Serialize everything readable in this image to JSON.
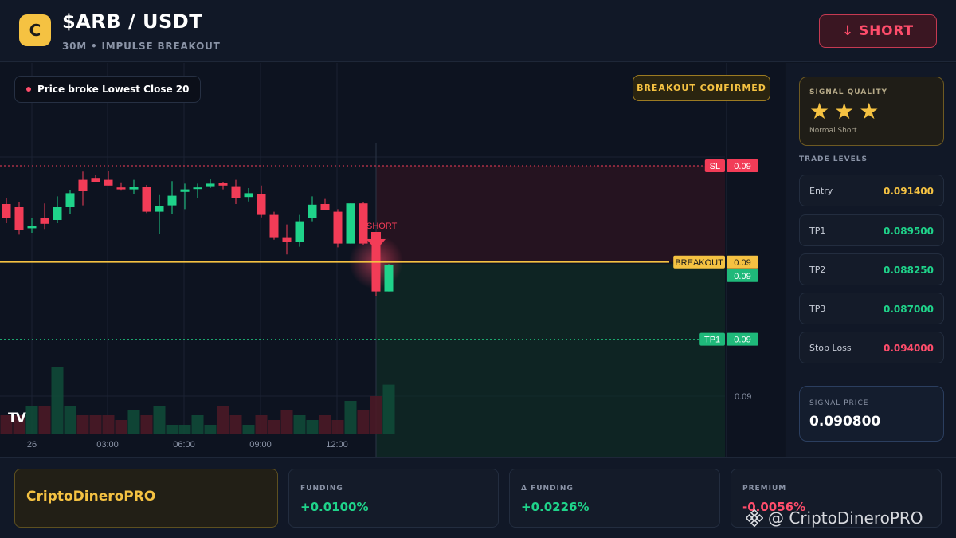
{
  "header": {
    "logo_letter": "C",
    "pair": "$ARB / USDT",
    "subtitle": "30M • IMPULSE BREAKOUT",
    "short_button": "SHORT"
  },
  "chart": {
    "note": "Price broke Lowest Close 20",
    "status_badge": "BREAKOUT CONFIRMED",
    "signal_marker": "SHORT",
    "tv_logo": "TV",
    "level_tags": [
      {
        "name": "SL",
        "value": "0.09",
        "color": "#f23c57"
      },
      {
        "name": "BREAKOUT",
        "value": "0.09",
        "color": "#f5c242"
      },
      {
        "name": "",
        "value": "0.09",
        "color": "#1fb97a"
      },
      {
        "name": "TP1",
        "value": "0.09",
        "color": "#1fb97a"
      }
    ],
    "axis_label": "0.09",
    "time_labels": [
      "26",
      "03:00",
      "06:00",
      "09:00",
      "12:00"
    ]
  },
  "chart_data": {
    "type": "candlestick",
    "candles": [
      {
        "o": 6,
        "h": 7,
        "l": 3,
        "c": 3.8
      },
      {
        "o": 5.5,
        "h": 6.3,
        "l": 1.2,
        "c": 2.0
      },
      {
        "o": 2.2,
        "h": 3.8,
        "l": 1.5,
        "c": 2.6
      },
      {
        "o": 3.8,
        "h": 6.1,
        "l": 2.1,
        "c": 2.9
      },
      {
        "o": 3.5,
        "h": 7.2,
        "l": 3.0,
        "c": 5.5
      },
      {
        "o": 5.5,
        "h": 8.2,
        "l": 4.5,
        "c": 7.7
      },
      {
        "o": 9.8,
        "h": 11.1,
        "l": 5.8,
        "c": 8.0
      },
      {
        "o": 10.1,
        "h": 10.6,
        "l": 9.5,
        "c": 9.5
      },
      {
        "o": 9.8,
        "h": 11.2,
        "l": 8.9,
        "c": 8.9
      },
      {
        "o": 8.6,
        "h": 9.4,
        "l": 8.1,
        "c": 8.3
      },
      {
        "o": 8.3,
        "h": 9.8,
        "l": 7.5,
        "c": 8.7
      },
      {
        "o": 8.7,
        "h": 9.0,
        "l": 4.6,
        "c": 4.8
      },
      {
        "o": 4.8,
        "h": 7.4,
        "l": 1.3,
        "c": 5.7
      },
      {
        "o": 5.8,
        "h": 9.6,
        "l": 4.5,
        "c": 7.3
      },
      {
        "o": 7.9,
        "h": 9.2,
        "l": 5.2,
        "c": 8.3
      },
      {
        "o": 8.5,
        "h": 9.2,
        "l": 7.0,
        "c": 8.6
      },
      {
        "o": 8.8,
        "h": 10.0,
        "l": 8.5,
        "c": 9.2
      },
      {
        "o": 9.3,
        "h": 9.5,
        "l": 8.3,
        "c": 8.9
      },
      {
        "o": 8.8,
        "h": 9.8,
        "l": 6.0,
        "c": 6.9
      },
      {
        "o": 7.1,
        "h": 8.5,
        "l": 6.4,
        "c": 7.7
      },
      {
        "o": 7.6,
        "h": 8.9,
        "l": 3.9,
        "c": 4.3
      },
      {
        "o": 4.3,
        "h": 4.8,
        "l": 0.4,
        "c": 0.8
      },
      {
        "o": 0.8,
        "h": 2.8,
        "l": -1.9,
        "c": 0.1
      },
      {
        "o": 0.1,
        "h": 4.3,
        "l": -0.7,
        "c": 3.3
      },
      {
        "o": 3.8,
        "h": 7.2,
        "l": 3.3,
        "c": 5.9
      },
      {
        "o": 6.0,
        "h": 6.8,
        "l": 5.0,
        "c": 5.1
      },
      {
        "o": 4.8,
        "h": 5.2,
        "l": -0.8,
        "c": -0.2
      },
      {
        "o": -0.2,
        "h": 6.1,
        "l": -0.2,
        "c": 6.1
      },
      {
        "o": 6.1,
        "h": 6.3,
        "l": -0.4,
        "c": -0.2
      },
      {
        "o": -0.2,
        "h": 0.4,
        "l": -8.5,
        "c": -7.7
      },
      {
        "o": -7.7,
        "h": -3.4,
        "l": -7.7,
        "c": -3.5
      }
    ],
    "volumes": [
      2,
      2,
      3,
      3,
      7,
      3,
      2,
      2,
      2,
      1.5,
      2.5,
      2,
      3,
      1,
      1,
      2,
      1,
      3,
      2,
      1,
      2,
      1.5,
      2.5,
      2,
      1.5,
      2,
      1.5,
      3.5,
      2.5,
      4,
      5.2
    ],
    "levels": {
      "sl": 12.0,
      "breakout": -3.1,
      "tp_zone_top": -3.4,
      "tp1": -15.2
    },
    "signal_index": 29
  },
  "sidebar": {
    "quality_title": "SIGNAL QUALITY",
    "stars": "★★★",
    "quality_sub": "Normal Short",
    "levels_title": "TRADE LEVELS",
    "levels": [
      {
        "label": "Entry",
        "value": "0.091400",
        "color": "#f5c242"
      },
      {
        "label": "TP1",
        "value": "0.089500",
        "color": "#1fd38a"
      },
      {
        "label": "TP2",
        "value": "0.088250",
        "color": "#1fd38a"
      },
      {
        "label": "TP3",
        "value": "0.087000",
        "color": "#1fd38a"
      },
      {
        "label": "Stop Loss",
        "value": "0.094000",
        "color": "#ff4d6b"
      }
    ],
    "signal_price_title": "SIGNAL PRICE",
    "signal_price": "0.090800"
  },
  "bottom": {
    "brand": "CriptoDineroPRO",
    "stats": [
      {
        "label": "FUNDING",
        "value": "+0.0100%",
        "color": "#1fd38a"
      },
      {
        "label": "Δ FUNDING",
        "value": "+0.0226%",
        "color": "#1fd38a"
      },
      {
        "label": "PREMIUM",
        "value": "-0.0056%",
        "color": "#ff4d6b"
      }
    ],
    "watermark": "@ CriptoDineroPRO"
  }
}
